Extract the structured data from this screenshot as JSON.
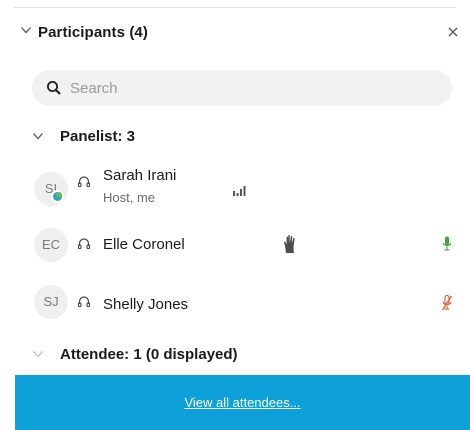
{
  "panel": {
    "title": "Participants (4)",
    "close_icon": "close-icon"
  },
  "search": {
    "placeholder": "Search",
    "value": ""
  },
  "sections": [
    {
      "title": "Panelist: 3",
      "expanded": true
    },
    {
      "title": "Attendee: 1 (0 displayed)",
      "expanded": false
    }
  ],
  "panelists": [
    {
      "initials": "SI",
      "name": "Sarah Irani",
      "subtitle": "Host, me",
      "presence": "online",
      "audio": "headset",
      "indicator": "signal-bars-icon"
    },
    {
      "initials": "EC",
      "name": "Elle Coronel",
      "subtitle": "",
      "audio": "headset",
      "hand_raised": true,
      "mic": "unmuted",
      "mic_color": "#3aa83a"
    },
    {
      "initials": "SJ",
      "name": "Shelly Jones",
      "subtitle": "",
      "audio": "headset",
      "mic": "muted",
      "mic_color": "#e05a2a"
    }
  ],
  "footer": {
    "link_label": "View all attendees...",
    "background": "#0ea0d9"
  }
}
